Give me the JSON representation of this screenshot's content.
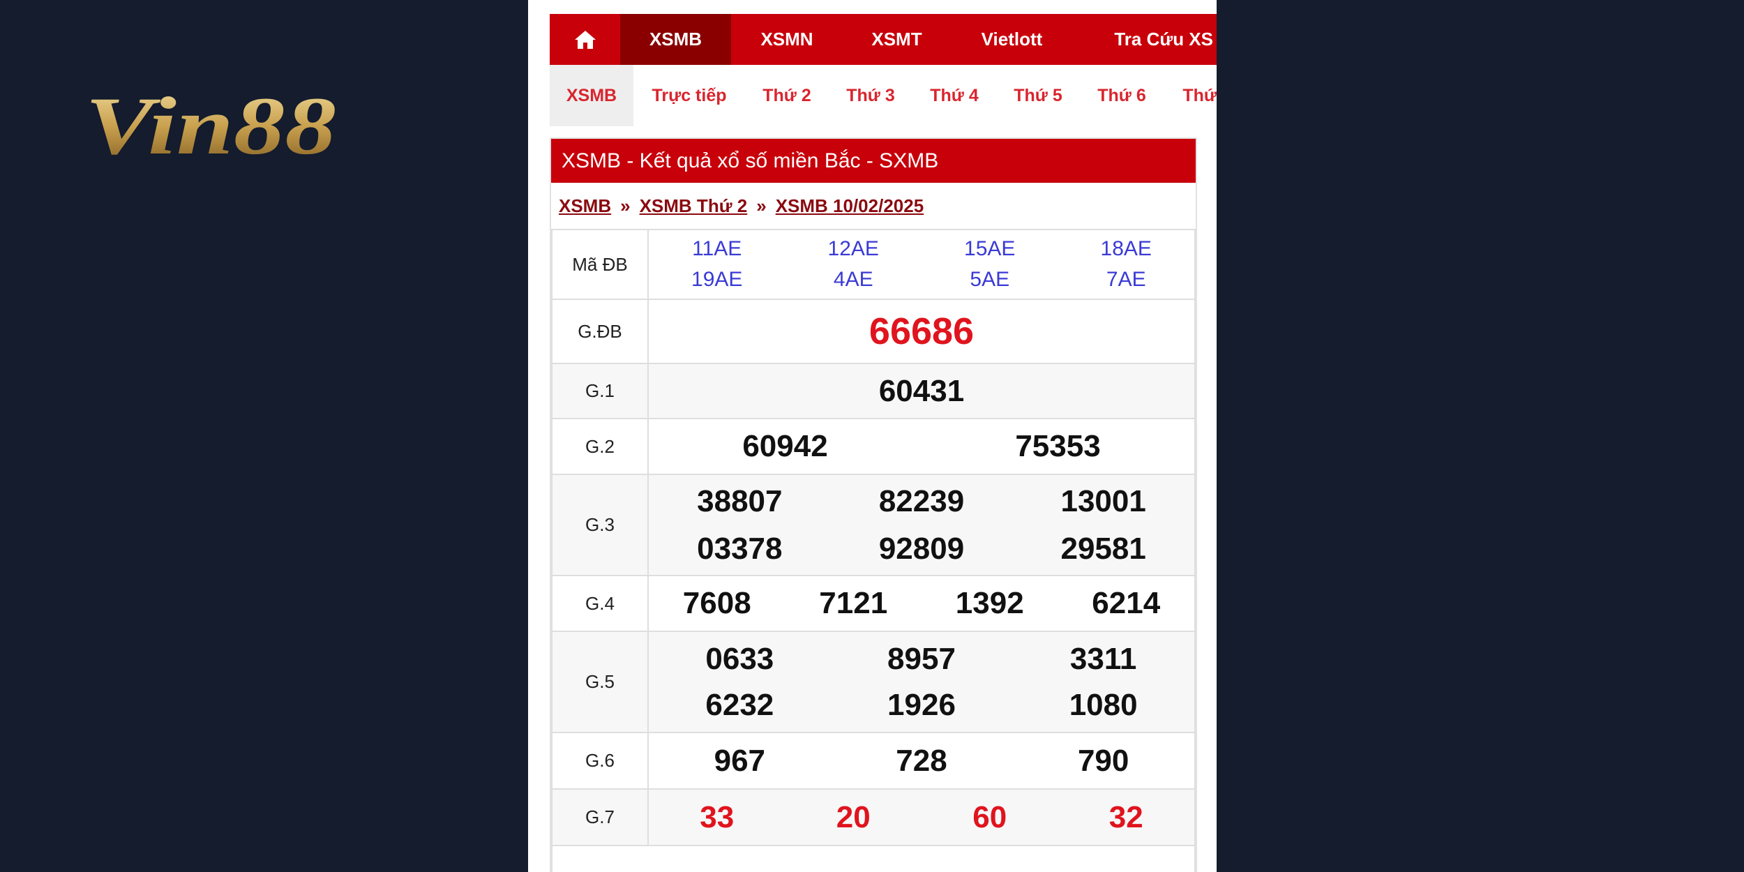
{
  "brand": {
    "logo_text": "Vin88"
  },
  "topnav": {
    "items": [
      {
        "label": "XSMB"
      },
      {
        "label": "XSMN"
      },
      {
        "label": "XSMT"
      },
      {
        "label": "Vietlott"
      },
      {
        "label": "Tra Cứu XS"
      }
    ]
  },
  "subnav": {
    "items": [
      {
        "label": "XSMB"
      },
      {
        "label": "Trực tiếp"
      },
      {
        "label": "Thứ 2"
      },
      {
        "label": "Thứ 3"
      },
      {
        "label": "Thứ 4"
      },
      {
        "label": "Thứ 5"
      },
      {
        "label": "Thứ 6"
      },
      {
        "label": "Thứ"
      }
    ]
  },
  "result": {
    "title": "XSMB - Kết quả xổ số miền Bắc - SXMB",
    "breadcrumb": [
      "XSMB",
      "XSMB Thứ 2",
      "XSMB 10/02/2025"
    ],
    "breadcrumb_sep": "»",
    "ma_db": {
      "label": "Mã ĐB",
      "codes": [
        "11AE",
        "12AE",
        "15AE",
        "18AE",
        "19AE",
        "4AE",
        "5AE",
        "7AE"
      ]
    },
    "prizes": [
      {
        "label": "G.ĐB",
        "numbers": [
          "66686"
        ]
      },
      {
        "label": "G.1",
        "numbers": [
          "60431"
        ]
      },
      {
        "label": "G.2",
        "numbers": [
          "60942",
          "75353"
        ]
      },
      {
        "label": "G.3",
        "numbers": [
          "38807",
          "82239",
          "13001",
          "03378",
          "92809",
          "29581"
        ]
      },
      {
        "label": "G.4",
        "numbers": [
          "7608",
          "7121",
          "1392",
          "6214"
        ]
      },
      {
        "label": "G.5",
        "numbers": [
          "0633",
          "8957",
          "3311",
          "6232",
          "1926",
          "1080"
        ]
      },
      {
        "label": "G.6",
        "numbers": [
          "967",
          "728",
          "790"
        ]
      },
      {
        "label": "G.7",
        "numbers": [
          "33",
          "20",
          "60",
          "32"
        ]
      }
    ]
  },
  "colors": {
    "primary_red": "#c8000a",
    "dark_red": "#8a0000",
    "number_red": "#e0141e",
    "code_blue": "#3a3ad6",
    "page_bg": "#141c2d"
  }
}
